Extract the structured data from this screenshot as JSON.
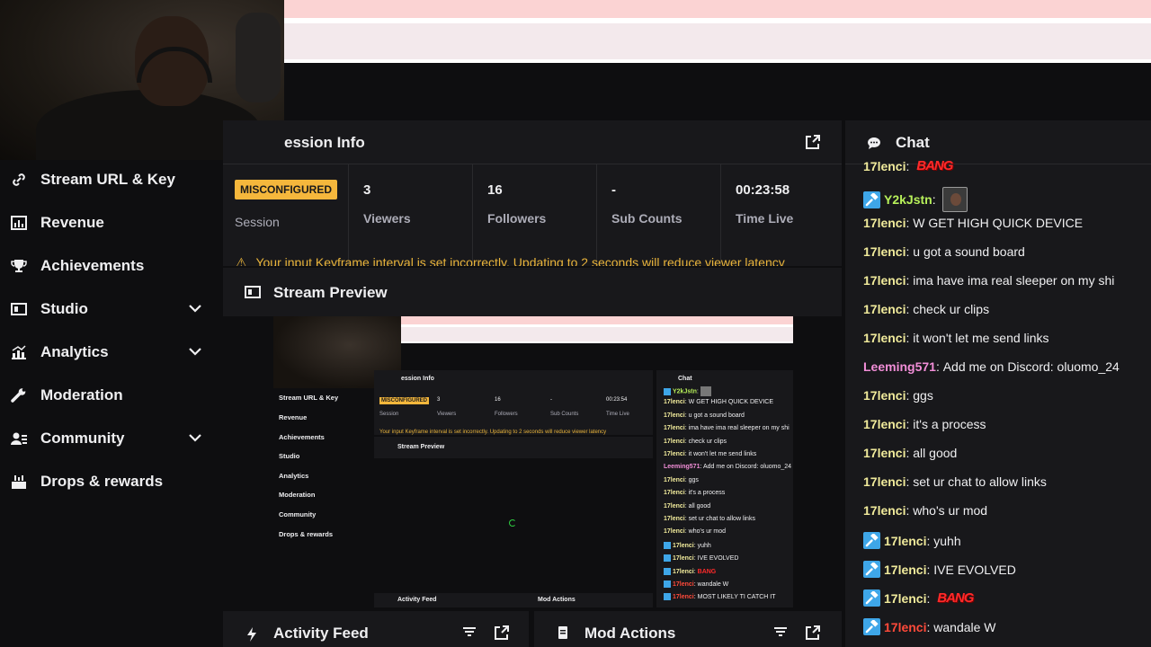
{
  "colors": {
    "accent": "#f5b73c",
    "mod_badge": "#3ea6e8",
    "warning": "#e9b43b"
  },
  "sidebar": {
    "items": [
      {
        "label": "Stream URL & Key",
        "icon": "link-icon"
      },
      {
        "label": "Revenue",
        "icon": "revenue-icon"
      },
      {
        "label": "Achievements",
        "icon": "trophy-icon"
      },
      {
        "label": "Studio",
        "icon": "studio-icon",
        "expandable": true
      },
      {
        "label": "Analytics",
        "icon": "analytics-icon",
        "expandable": true
      },
      {
        "label": "Moderation",
        "icon": "wrench-icon"
      },
      {
        "label": "Community",
        "icon": "community-icon",
        "expandable": true
      },
      {
        "label": "Drops & rewards",
        "icon": "drops-icon"
      }
    ]
  },
  "session": {
    "title": "ession Info",
    "badge": "MISCONFIGURED",
    "session_label": "Session",
    "stats": [
      {
        "value": "3",
        "label": "Viewers"
      },
      {
        "value": "16",
        "label": "Followers"
      },
      {
        "value": "-",
        "label": "Sub Counts"
      },
      {
        "value": "00:23:58",
        "label": "Time Live"
      }
    ],
    "warning": "Your input Keyframe interval is set incorrectly. Updating to 2 seconds will reduce viewer latency"
  },
  "preview": {
    "title": "Stream Preview"
  },
  "feed": {
    "title": "Activity Feed"
  },
  "mod": {
    "title": "Mod Actions"
  },
  "chat": {
    "title": "Chat",
    "messages": [
      {
        "user": "17lenci",
        "color": "#f0ea9b",
        "msg": "",
        "bang": "BANG",
        "mod": false
      },
      {
        "user": "Y2kJstn",
        "color": "#b7f05a",
        "msg": "",
        "emote": true,
        "mod": true
      },
      {
        "user": "17lenci",
        "color": "#f0ea9b",
        "msg": "W GET HIGH QUICK DEVICE",
        "mod": false
      },
      {
        "user": "17lenci",
        "color": "#f0ea9b",
        "msg": "u got a sound board",
        "mod": false
      },
      {
        "user": "17lenci",
        "color": "#f0ea9b",
        "msg": "ima have ima real sleeper on my shi",
        "mod": false
      },
      {
        "user": "17lenci",
        "color": "#f0ea9b",
        "msg": "check ur clips",
        "mod": false
      },
      {
        "user": "17lenci",
        "color": "#f0ea9b",
        "msg": "it won't let me send links",
        "mod": false
      },
      {
        "user": "Leeming571",
        "color": "#f28ed8",
        "msg": "Add me on Discord: oluomo_24",
        "mod": false
      },
      {
        "user": "17lenci",
        "color": "#f0ea9b",
        "msg": "ggs",
        "mod": false
      },
      {
        "user": "17lenci",
        "color": "#f0ea9b",
        "msg": "it's a process",
        "mod": false
      },
      {
        "user": "17lenci",
        "color": "#f0ea9b",
        "msg": "all good",
        "mod": false
      },
      {
        "user": "17lenci",
        "color": "#f0ea9b",
        "msg": "set ur chat to allow links",
        "mod": false
      },
      {
        "user": "17lenci",
        "color": "#f0ea9b",
        "msg": "who's ur mod",
        "mod": false
      },
      {
        "user": "17lenci",
        "color": "#f0ea9b",
        "msg": "yuhh",
        "mod": true
      },
      {
        "user": "17lenci",
        "color": "#f0ea9b",
        "msg": "IVE EVOLVED",
        "mod": true
      },
      {
        "user": "17lenci",
        "color": "#f0ea9b",
        "msg": "",
        "bang": "BANG",
        "mod": true
      },
      {
        "user": "17lenci",
        "color": "#ff4a3a",
        "msg": "wandale W",
        "mod": true
      }
    ]
  },
  "mini": {
    "nav": [
      "Stream URL & Key",
      "Revenue",
      "Achievements",
      "Studio",
      "Analytics",
      "Moderation",
      "Community",
      "Drops & rewards"
    ],
    "session_title": "ession Info",
    "badge": "MISCONFIGURED",
    "session_label": "Session",
    "stats": [
      {
        "value": "3",
        "label": "Viewers"
      },
      {
        "value": "16",
        "label": "Followers"
      },
      {
        "value": "-",
        "label": "Sub Counts"
      },
      {
        "value": "00:23:54",
        "label": "Time Live"
      }
    ],
    "warning": "Your input Keyframe interval is set incorrectly. Updating to 2 seconds will reduce viewer latency",
    "preview_title": "Stream Preview",
    "chat_title": "Chat",
    "feed_title": "Activity Feed",
    "mod_title": "Mod Actions",
    "chat": [
      {
        "user": "Y2kJstn",
        "color": "#b7f05a",
        "msg": "",
        "mod": true,
        "emote": true
      },
      {
        "user": "17lenci",
        "color": "#f0ea9b",
        "msg": "W GET HIGH QUICK DEVICE"
      },
      {
        "user": "17lenci",
        "color": "#f0ea9b",
        "msg": "u got a sound board"
      },
      {
        "user": "17lenci",
        "color": "#f0ea9b",
        "msg": "ima have ima real sleeper on my shi"
      },
      {
        "user": "17lenci",
        "color": "#f0ea9b",
        "msg": "check ur clips"
      },
      {
        "user": "17lenci",
        "color": "#f0ea9b",
        "msg": "it won't let me send links"
      },
      {
        "user": "Leeming571",
        "color": "#f28ed8",
        "msg": "Add me on Discord: oluomo_24"
      },
      {
        "user": "17lenci",
        "color": "#f0ea9b",
        "msg": "ggs"
      },
      {
        "user": "17lenci",
        "color": "#f0ea9b",
        "msg": "it's a process"
      },
      {
        "user": "17lenci",
        "color": "#f0ea9b",
        "msg": "all good"
      },
      {
        "user": "17lenci",
        "color": "#f0ea9b",
        "msg": "set ur chat to allow links"
      },
      {
        "user": "17lenci",
        "color": "#f0ea9b",
        "msg": "who's ur mod"
      },
      {
        "user": "17lenci",
        "color": "#f0ea9b",
        "msg": "yuhh",
        "mod": true
      },
      {
        "user": "17lenci",
        "color": "#f0ea9b",
        "msg": "IVE EVOLVED",
        "mod": true
      },
      {
        "user": "17lenci",
        "color": "#f0ea9b",
        "msg": "",
        "mod": true,
        "bang": "BANG"
      },
      {
        "user": "17lenci",
        "color": "#ff4a3a",
        "msg": "wandale W",
        "mod": true
      },
      {
        "user": "17lenci",
        "color": "#ff4a3a",
        "msg": "MOST LIKELY TI CATCH IT",
        "mod": true
      }
    ]
  }
}
